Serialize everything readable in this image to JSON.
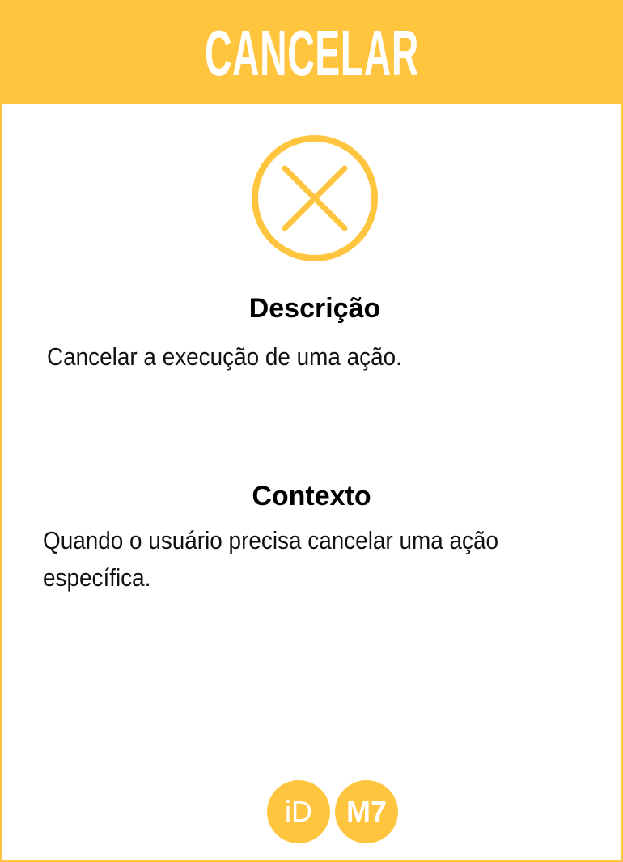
{
  "header": {
    "title": "CANCELAR"
  },
  "icon": {
    "name": "cancel-circle-x-icon",
    "color": "#FFC53F"
  },
  "description": {
    "heading": "Descrição",
    "text": "Cancelar a execução de uma ação."
  },
  "context": {
    "heading": "Contexto",
    "text": "Quando o usuário precisa cancelar uma ação específica."
  },
  "badges": [
    {
      "label": "iD"
    },
    {
      "label": "M7"
    }
  ],
  "colors": {
    "accent": "#FFC53F"
  }
}
